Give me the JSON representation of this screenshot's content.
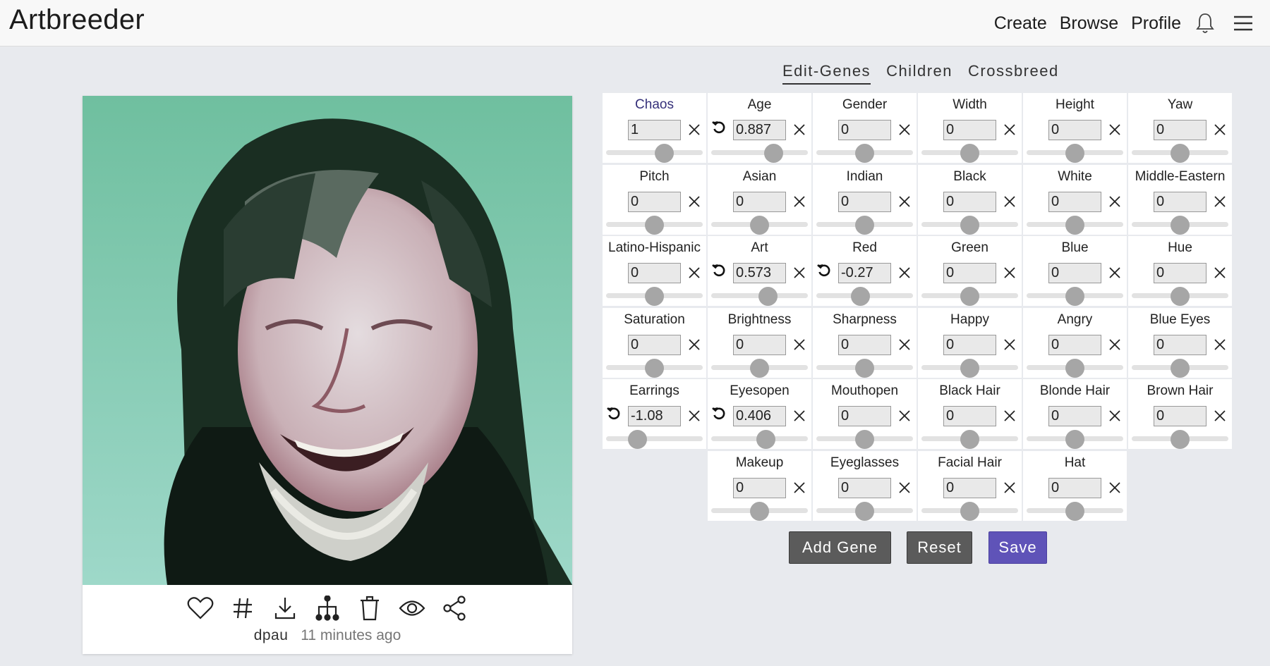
{
  "app": {
    "title": "Artbreeder"
  },
  "nav": {
    "create": "Create",
    "browse": "Browse",
    "profile": "Profile"
  },
  "tabs": [
    {
      "label": "Edit-Genes",
      "active": true
    },
    {
      "label": "Children",
      "active": false
    },
    {
      "label": "Crossbreed",
      "active": false
    }
  ],
  "image_meta": {
    "user": "dpau",
    "time": "11 minutes ago"
  },
  "genes": [
    {
      "name": "Chaos",
      "value": "1",
      "level": 0.63,
      "highlight": true
    },
    {
      "name": "Age",
      "value": "0.887",
      "level": 0.68,
      "modified": true
    },
    {
      "name": "Gender",
      "value": "0",
      "level": 0.5
    },
    {
      "name": "Width",
      "value": "0",
      "level": 0.5
    },
    {
      "name": "Height",
      "value": "0",
      "level": 0.5
    },
    {
      "name": "Yaw",
      "value": "0",
      "level": 0.5
    },
    {
      "name": "Pitch",
      "value": "0",
      "level": 0.5
    },
    {
      "name": "Asian",
      "value": "0",
      "level": 0.5
    },
    {
      "name": "Indian",
      "value": "0",
      "level": 0.5
    },
    {
      "name": "Black",
      "value": "0",
      "level": 0.5
    },
    {
      "name": "White",
      "value": "0",
      "level": 0.5
    },
    {
      "name": "Middle-Eastern",
      "value": "0",
      "level": 0.5
    },
    {
      "name": "Latino-Hispanic",
      "value": "0",
      "level": 0.5
    },
    {
      "name": "Art",
      "value": "0.573",
      "level": 0.61,
      "modified": true
    },
    {
      "name": "Red",
      "value": "-0.27",
      "level": 0.45,
      "modified": true
    },
    {
      "name": "Green",
      "value": "0",
      "level": 0.5
    },
    {
      "name": "Blue",
      "value": "0",
      "level": 0.5
    },
    {
      "name": "Hue",
      "value": "0",
      "level": 0.5
    },
    {
      "name": "Saturation",
      "value": "0",
      "level": 0.5
    },
    {
      "name": "Brightness",
      "value": "0",
      "level": 0.5
    },
    {
      "name": "Sharpness",
      "value": "0",
      "level": 0.5
    },
    {
      "name": "Happy",
      "value": "0",
      "level": 0.5
    },
    {
      "name": "Angry",
      "value": "0",
      "level": 0.5
    },
    {
      "name": "Blue Eyes",
      "value": "0",
      "level": 0.5
    },
    {
      "name": "Earrings",
      "value": "-1.08",
      "level": 0.28,
      "modified": true
    },
    {
      "name": "Eyesopen",
      "value": "0.406",
      "level": 0.58,
      "modified": true
    },
    {
      "name": "Mouthopen",
      "value": "0",
      "level": 0.5
    },
    {
      "name": "Black Hair",
      "value": "0",
      "level": 0.5
    },
    {
      "name": "Blonde Hair",
      "value": "0",
      "level": 0.5
    },
    {
      "name": "Brown Hair",
      "value": "0",
      "level": 0.5
    },
    {
      "name": "Makeup",
      "value": "0",
      "level": 0.5
    },
    {
      "name": "Eyeglasses",
      "value": "0",
      "level": 0.5
    },
    {
      "name": "Facial Hair",
      "value": "0",
      "level": 0.5
    },
    {
      "name": "Hat",
      "value": "0",
      "level": 0.5
    }
  ],
  "buttons": {
    "add_gene": "Add Gene",
    "reset": "Reset",
    "save": "Save"
  },
  "colors": {
    "accent": "#5f53b8",
    "button_gray": "#5b5b5b",
    "chaos_label": "#35307a"
  },
  "icons": [
    "bell-icon",
    "menu-icon",
    "heart-icon",
    "hashtag-icon",
    "download-icon",
    "family-tree-icon",
    "trash-icon",
    "eye-icon",
    "share-icon",
    "undo-icon",
    "close-icon"
  ]
}
